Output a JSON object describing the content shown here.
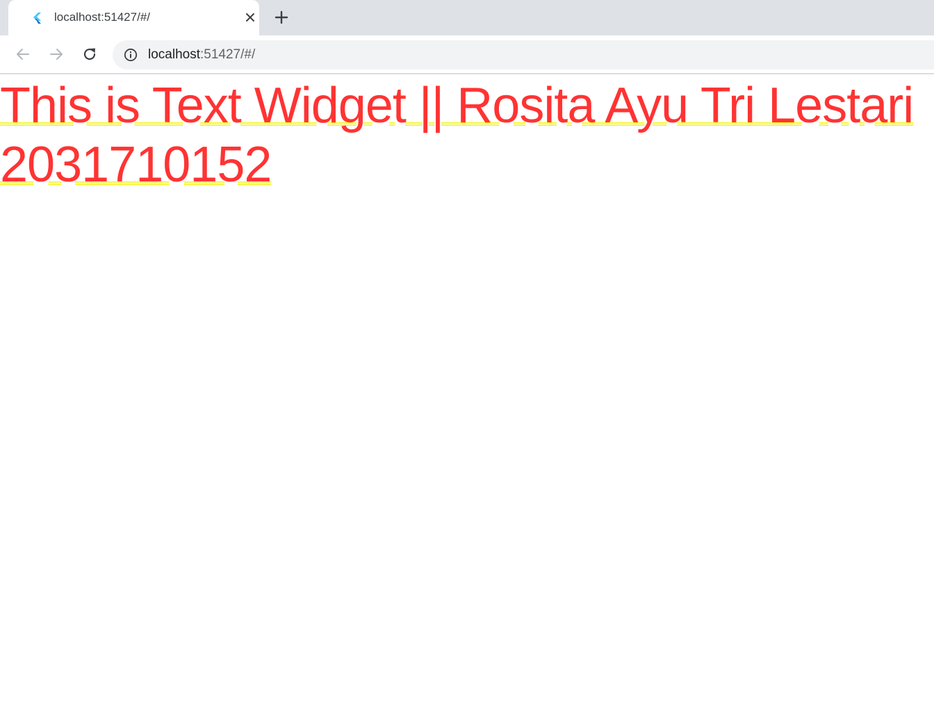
{
  "browser": {
    "tab": {
      "title": "localhost:51427/#/",
      "favicon": "flutter-logo-icon",
      "close_icon": "close-icon"
    },
    "new_tab_icon": "plus-icon",
    "toolbar": {
      "back_icon": "back-arrow-icon",
      "forward_icon": "forward-arrow-icon",
      "reload_icon": "reload-icon",
      "info_icon": "info-icon",
      "url_host": "localhost",
      "url_rest": ":51427/#/"
    }
  },
  "page": {
    "text_widget": "This is Text Widget || Rosita Ayu Tri Lestari 2031710152",
    "text_color": "#ff3333",
    "underline_color": "#f6f63a"
  }
}
